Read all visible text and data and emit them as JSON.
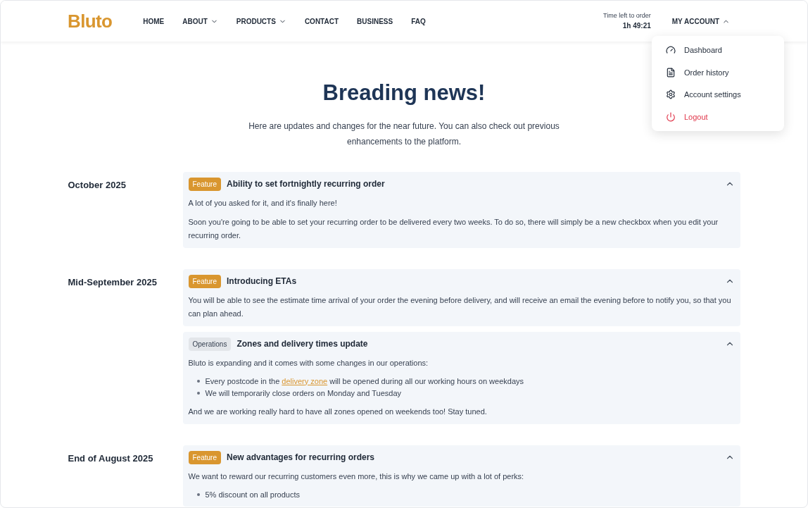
{
  "header": {
    "logo": "Bluto",
    "nav": [
      {
        "label": "HOME",
        "dropdown": false
      },
      {
        "label": "ABOUT",
        "dropdown": true
      },
      {
        "label": "PRODUCTS",
        "dropdown": true
      },
      {
        "label": "CONTACT",
        "dropdown": false
      },
      {
        "label": "BUSINESS",
        "dropdown": false
      },
      {
        "label": "FAQ",
        "dropdown": false
      }
    ],
    "timer": {
      "label": "Time left to order",
      "value": "1h 49:21"
    },
    "account": {
      "label": "MY ACCOUNT",
      "expanded": true,
      "menu": [
        {
          "label": "Dashboard",
          "kind": "dashboard"
        },
        {
          "label": "Order history",
          "kind": "history"
        },
        {
          "label": "Account settings",
          "kind": "settings"
        },
        {
          "label": "Logout",
          "kind": "logout"
        }
      ]
    }
  },
  "hero": {
    "title": "Breading news!",
    "subtitle": "Here are updates and changes for the near future. You can also check out previous enhancements to the platform."
  },
  "sections": [
    {
      "date": "October 2025",
      "entries": [
        {
          "tag": "Feature",
          "kind": "feature",
          "title": "Ability to set fortnightly recurring order",
          "expanded": true,
          "blocks": [
            {
              "kind": "p",
              "text": "A lot of you asked for it, and it's finally here!"
            },
            {
              "kind": "p",
              "text": "Soon you're going to be able to set your recurring order to be delivered every two weeks. To do so, there will simply be a new checkbox when you edit your recurring order."
            }
          ]
        }
      ]
    },
    {
      "date": "Mid-September 2025",
      "entries": [
        {
          "tag": "Feature",
          "kind": "feature",
          "title": "Introducing ETAs",
          "expanded": true,
          "blocks": [
            {
              "kind": "p",
              "text": "You will be able to see the estimate time arrival of your order the evening before delivery, and will receive an email the evening before to notify you, so that you can plan ahead."
            }
          ]
        },
        {
          "tag": "Operations",
          "kind": "operations",
          "title": "Zones and delivery times update",
          "expanded": true,
          "blocks": [
            {
              "kind": "p",
              "text": "Bluto is expanding and it comes with some changes in our operations:"
            },
            {
              "kind": "list",
              "items": [
                [
                  {
                    "text": "Every postcode in the "
                  },
                  {
                    "text": "delivery zone",
                    "link": true
                  },
                  {
                    "text": " will be opened during all our working hours on weekdays"
                  }
                ],
                [
                  {
                    "text": "We will temporarily close orders on Monday and Tuesday"
                  }
                ]
              ]
            },
            {
              "kind": "p",
              "text": "And we are working really hard to have all zones opened on weekends too! Stay tuned."
            }
          ]
        }
      ]
    },
    {
      "date": "End of August 2025",
      "entries": [
        {
          "tag": "Feature",
          "kind": "feature",
          "title": "New advantages for recurring orders",
          "expanded": true,
          "blocks": [
            {
              "kind": "p",
              "text": "We want to reward our recurring customers even more, this is why we came up with a lot of perks:"
            },
            {
              "kind": "list",
              "items": [
                [
                  {
                    "text": "5% discount on all products"
                  }
                ]
              ]
            }
          ]
        }
      ]
    }
  ]
}
